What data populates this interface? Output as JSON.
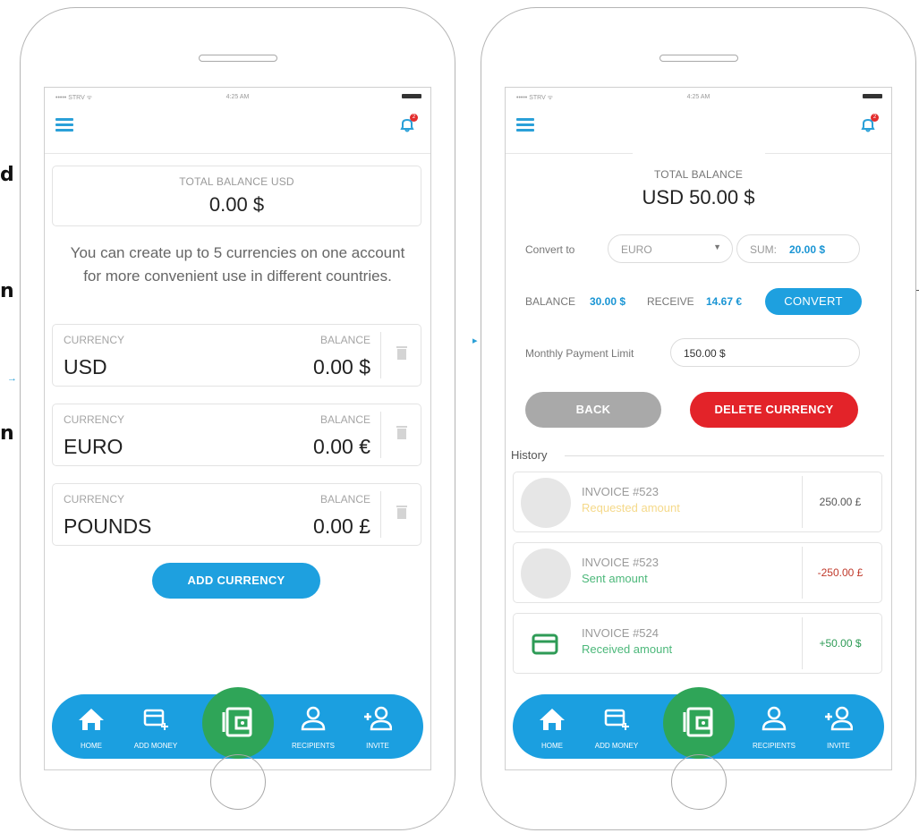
{
  "fragments": {
    "left_chars": [
      "d",
      "n",
      "n"
    ]
  },
  "left_screen": {
    "status": {
      "carrier": "••••• STRV ᯤ",
      "time": "4:25 AM"
    },
    "notification_count": "2",
    "total_balance": {
      "label": "TOTAL BALANCE USD",
      "amount": "0.00 $"
    },
    "info_text": "You can create up to 5 currencies on one account for more convenient use in different countries.",
    "currencies": [
      {
        "currency_label": "CURRENCY",
        "name": "USD",
        "balance_label": "BALANCE",
        "amount": "0.00 $"
      },
      {
        "currency_label": "CURRENCY",
        "name": "EURO",
        "balance_label": "BALANCE",
        "amount": "0.00 €"
      },
      {
        "currency_label": "CURRENCY",
        "name": "POUNDS",
        "balance_label": "BALANCE",
        "amount": "0.00 £"
      }
    ],
    "add_currency_label": "ADD CURRENCY"
  },
  "right_screen": {
    "status": {
      "carrier": "••••• STRV ᯤ",
      "time": "4:25 AM"
    },
    "notification_count": "2",
    "total_balance": {
      "label": "TOTAL BALANCE",
      "amount": "USD 50.00 $"
    },
    "convert": {
      "label": "Convert to",
      "selected_currency": "EURO",
      "sum_label": "SUM:",
      "sum_value": "20.00 $"
    },
    "balance_row": {
      "balance_label": "BALANCE",
      "balance_value": "30.00 $",
      "receive_label": "RECEIVE",
      "receive_value": "14.67 €",
      "convert_button": "CONVERT"
    },
    "monthly": {
      "label": "Monthly Payment Limit",
      "value": "150.00 $"
    },
    "back_label": "BACK",
    "delete_label": "DELETE CURRENCY",
    "history_title": "History",
    "history": [
      {
        "invoice": "INVOICE #523",
        "status": "Requested amount",
        "amount": "250.00 £"
      },
      {
        "invoice": "INVOICE #523",
        "status": "Sent amount",
        "amount": "-250.00 £"
      },
      {
        "invoice": "INVOICE #524",
        "status": "Received amount",
        "amount": "+50.00 $"
      }
    ]
  },
  "nav": {
    "home": "HOME",
    "add_money": "ADD MONEY",
    "recipients": "RECIPIENTS",
    "invite": "INVITE"
  },
  "colors": {
    "accent_blue": "#1ea0df",
    "nav_blue": "#1b9fe0",
    "green": "#2fa558",
    "red": "#e32329",
    "grey_button": "#a9a9a9",
    "requested_yellow": "#f5d98a",
    "sent_green": "#4cb87a",
    "received_green": "#4cb87a",
    "negative_red": "#c0392b",
    "positive_green": "#2e9b56"
  }
}
